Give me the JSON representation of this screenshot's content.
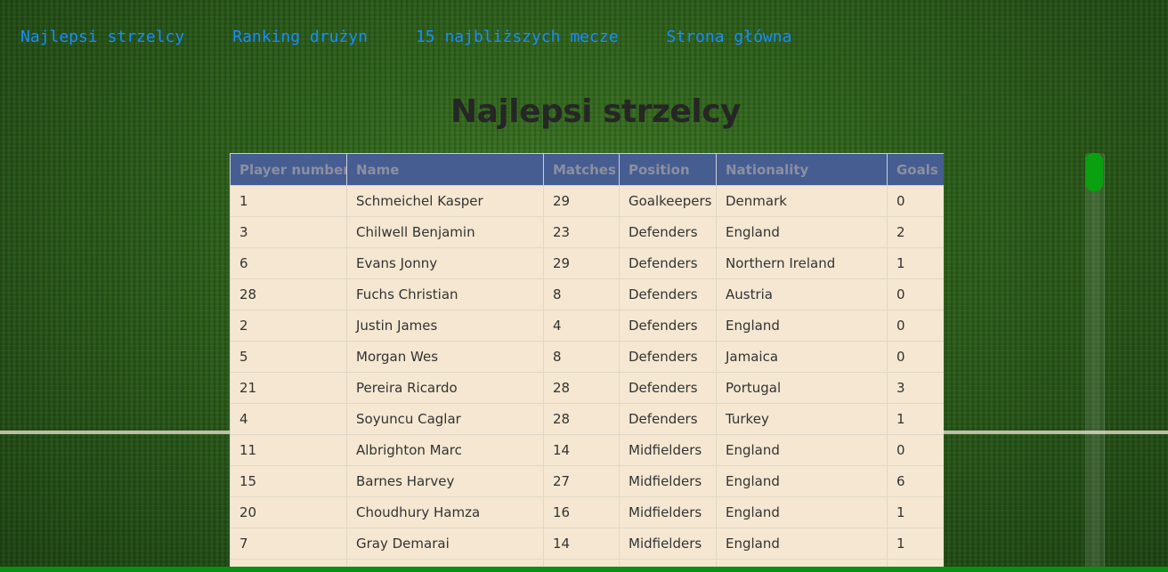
{
  "nav": {
    "items": [
      {
        "label": "Najlepsi strzelcy"
      },
      {
        "label": "Ranking drużyn"
      },
      {
        "label": "15 najbliższych mecze"
      },
      {
        "label": "Strona główna"
      }
    ]
  },
  "page": {
    "title": "Najlepsi strzelcy"
  },
  "table": {
    "headers": [
      "Player number",
      "Name",
      "Matches",
      "Position",
      "Nationality",
      "Goals"
    ],
    "rows": [
      [
        "1",
        "Schmeichel Kasper",
        "29",
        "Goalkeepers",
        "Denmark",
        "0"
      ],
      [
        "3",
        "Chilwell Benjamin",
        "23",
        "Defenders",
        "England",
        "2"
      ],
      [
        "6",
        "Evans Jonny",
        "29",
        "Defenders",
        "Northern Ireland",
        "1"
      ],
      [
        "28",
        "Fuchs Christian",
        "8",
        "Defenders",
        "Austria",
        "0"
      ],
      [
        "2",
        "Justin James",
        "4",
        "Defenders",
        "England",
        "0"
      ],
      [
        "5",
        "Morgan Wes",
        "8",
        "Defenders",
        "Jamaica",
        "0"
      ],
      [
        "21",
        "Pereira Ricardo",
        "28",
        "Defenders",
        "Portugal",
        "3"
      ],
      [
        "4",
        "Soyuncu Caglar",
        "28",
        "Defenders",
        "Turkey",
        "1"
      ],
      [
        "11",
        "Albrighton Marc",
        "14",
        "Midfielders",
        "England",
        "0"
      ],
      [
        "15",
        "Barnes Harvey",
        "27",
        "Midfielders",
        "England",
        "6"
      ],
      [
        "20",
        "Choudhury Hamza",
        "16",
        "Midfielders",
        "England",
        "1"
      ],
      [
        "7",
        "Gray Demarai",
        "14",
        "Midfielders",
        "England",
        "1"
      ],
      [
        "",
        "",
        "",
        "",
        "",
        ""
      ]
    ]
  },
  "colors": {
    "nav_link": "#1a8cff",
    "header_bg": "#465d91",
    "row_bg": "#f5e7d1",
    "scroll_thumb": "#0aa010"
  }
}
